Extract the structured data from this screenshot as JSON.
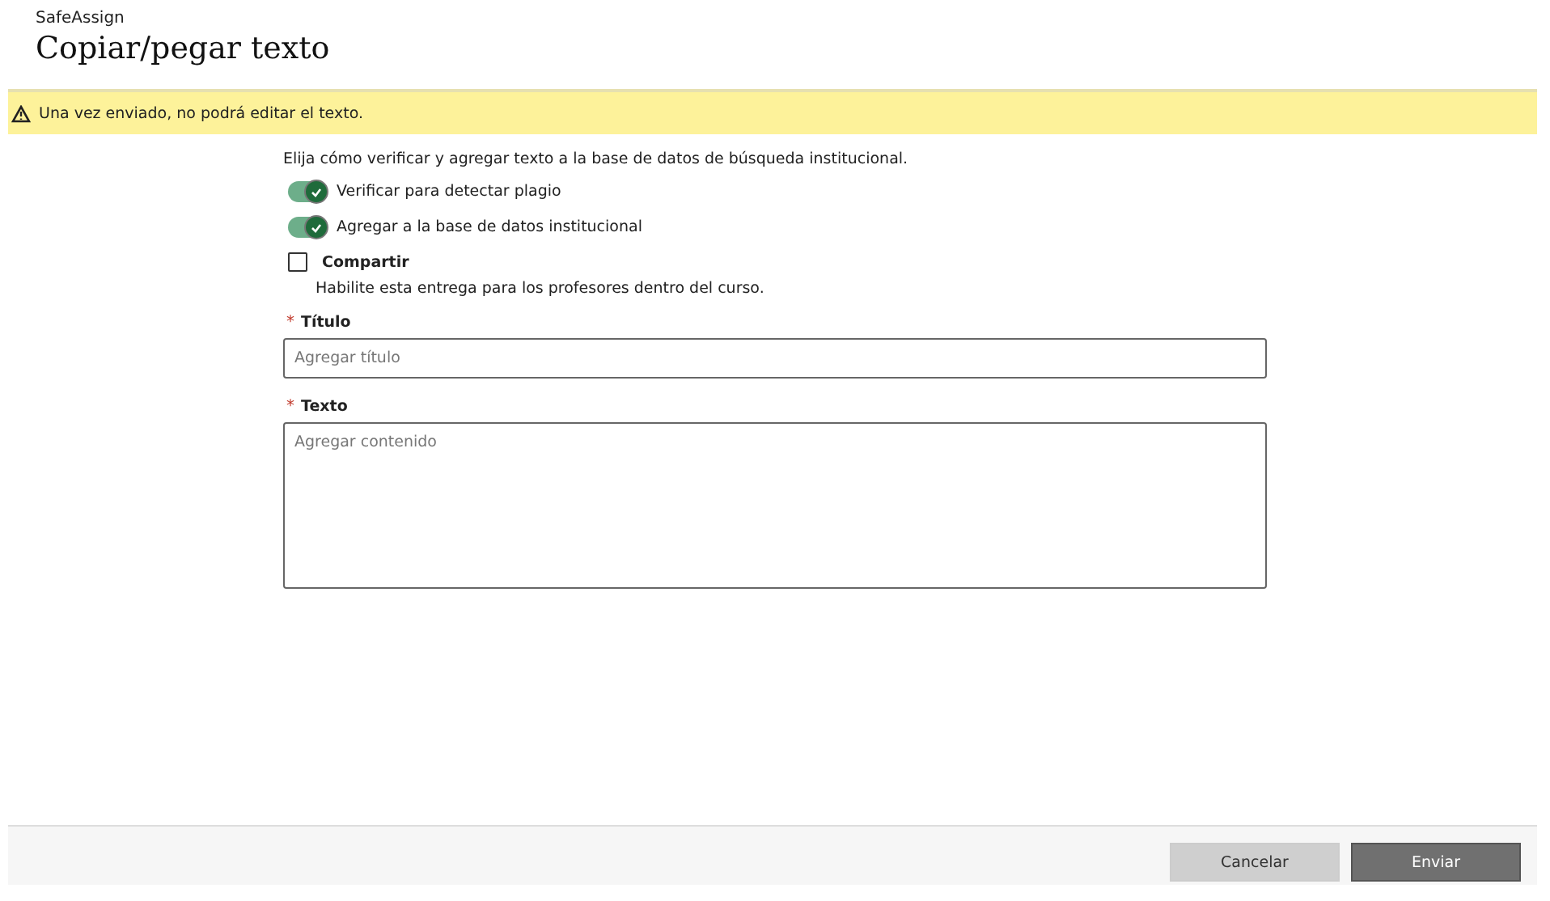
{
  "header": {
    "app_name": "SafeAssign",
    "title": "Copiar/pegar texto"
  },
  "warning": {
    "text": "Una vez enviado, no podrá editar el texto."
  },
  "intro": "Elija cómo verificar y agregar texto a la base de datos de búsqueda institucional.",
  "options": [
    {
      "kind": "toggle",
      "label": "Verificar para detectar plagio",
      "on": true
    },
    {
      "kind": "toggle",
      "label": "Agregar a la base de datos institucional",
      "on": true
    },
    {
      "kind": "checkbox",
      "label": "Compartir",
      "checked": false,
      "description": "Habilite esta entrega para los profesores dentro del curso."
    }
  ],
  "fields": [
    {
      "kind": "line",
      "required_mark": "*",
      "label": "Título",
      "placeholder": "Agregar título"
    },
    {
      "kind": "area",
      "required_mark": "*",
      "label": "Texto",
      "placeholder": "Agregar contenido"
    }
  ],
  "buttons": [
    {
      "label": "Cancelar",
      "primary": false
    },
    {
      "label": "Enviar",
      "primary": true
    }
  ]
}
